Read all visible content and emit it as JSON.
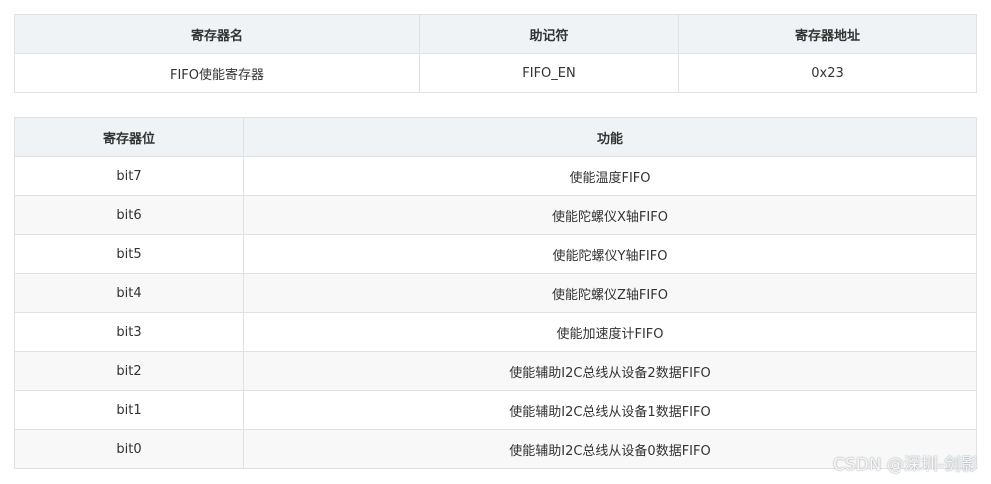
{
  "register_table": {
    "headers": [
      "寄存器名",
      "助记符",
      "寄存器地址"
    ],
    "row": [
      "FIFO使能寄存器",
      "FIFO_EN",
      "0x23"
    ]
  },
  "bits_table": {
    "headers": [
      "寄存器位",
      "功能"
    ],
    "rows": [
      [
        "bit7",
        "使能温度FIFO"
      ],
      [
        "bit6",
        "使能陀螺仪X轴FIFO"
      ],
      [
        "bit5",
        "使能陀螺仪Y轴FIFO"
      ],
      [
        "bit4",
        "使能陀螺仪Z轴FIFO"
      ],
      [
        "bit3",
        "使能加速度计FIFO"
      ],
      [
        "bit2",
        "使能辅助I2C总线从设备2数据FIFO"
      ],
      [
        "bit1",
        "使能辅助I2C总线从设备1数据FIFO"
      ],
      [
        "bit0",
        "使能辅助I2C总线从设备0数据FIFO"
      ]
    ]
  },
  "watermark": "CSDN @深圳-剑影"
}
